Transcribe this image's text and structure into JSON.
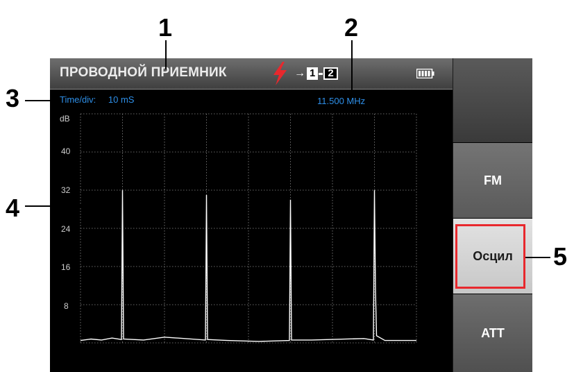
{
  "device": {
    "title": "ПРОВОДНОЙ ПРИЕМНИК",
    "channel": {
      "from": "1",
      "to": "2"
    },
    "time_div_label": "Time/div:",
    "time_div_value": "10 mS",
    "frequency": "11.500 MHz",
    "icons": [
      "lightning-bolt-icon",
      "arrow-right-icon",
      "battery-icon"
    ],
    "softkeys": [
      {
        "label": ""
      },
      {
        "label": "FM"
      },
      {
        "label": "Осцил",
        "selected": true
      },
      {
        "label": "ATT"
      }
    ]
  },
  "callouts": [
    "1",
    "2",
    "3",
    "4",
    "5"
  ],
  "colors": {
    "accent_blue": "#2e8fe8",
    "bolt_red": "#e8282d",
    "highlight_frame": "#e8282d",
    "trace": "#ffffff"
  },
  "chart_data": {
    "type": "line",
    "ylabel": "dB",
    "ylim": [
      0,
      48
    ],
    "y_ticks": [
      "40",
      "32",
      "24",
      "16",
      "8"
    ],
    "grid": true,
    "series": [
      {
        "values": [
          {
            "x": 0.0,
            "y": 0.5
          },
          {
            "x": 0.5,
            "y": 0.8
          },
          {
            "x": 1.0,
            "y": 0.6
          },
          {
            "x": 1.5,
            "y": 1.0
          },
          {
            "x": 1.95,
            "y": 0.7
          },
          {
            "x": 2.0,
            "y": 32
          },
          {
            "x": 2.05,
            "y": 0.8
          },
          {
            "x": 3.0,
            "y": 0.6
          },
          {
            "x": 4.0,
            "y": 1.2
          },
          {
            "x": 5.95,
            "y": 0.6
          },
          {
            "x": 6.0,
            "y": 31
          },
          {
            "x": 6.05,
            "y": 0.7
          },
          {
            "x": 7.0,
            "y": 0.5
          },
          {
            "x": 8.5,
            "y": 0.3
          },
          {
            "x": 9.95,
            "y": 0.5
          },
          {
            "x": 10.0,
            "y": 30
          },
          {
            "x": 10.05,
            "y": 0.6
          },
          {
            "x": 11.0,
            "y": 0.6
          },
          {
            "x": 13.5,
            "y": 0.9
          },
          {
            "x": 13.95,
            "y": 0.6
          },
          {
            "x": 14.0,
            "y": 32
          },
          {
            "x": 14.05,
            "y": 11
          },
          {
            "x": 14.1,
            "y": 1.5
          },
          {
            "x": 14.5,
            "y": 0.5
          },
          {
            "x": 16.0,
            "y": 0.5
          }
        ]
      }
    ]
  }
}
